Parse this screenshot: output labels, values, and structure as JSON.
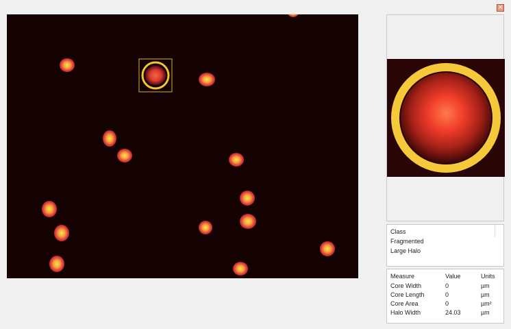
{
  "window": {
    "close_glyph": "×"
  },
  "classification": {
    "title": "Class",
    "items": [
      "Fragmented",
      "Large Halo"
    ]
  },
  "measurements": {
    "headers": [
      "Measure",
      "Value",
      "Units"
    ],
    "rows": [
      [
        "Core Width",
        "0",
        "µm"
      ],
      [
        "Core Length",
        "0",
        "µm"
      ],
      [
        "Core Area",
        "0",
        "µm²"
      ],
      [
        "Halo Width",
        "24.03",
        "µm"
      ]
    ]
  },
  "colors": {
    "background": "#150202",
    "cell_glow": "#e0433a",
    "cell_core": "#f3d84a",
    "selection": "#f2c531"
  }
}
